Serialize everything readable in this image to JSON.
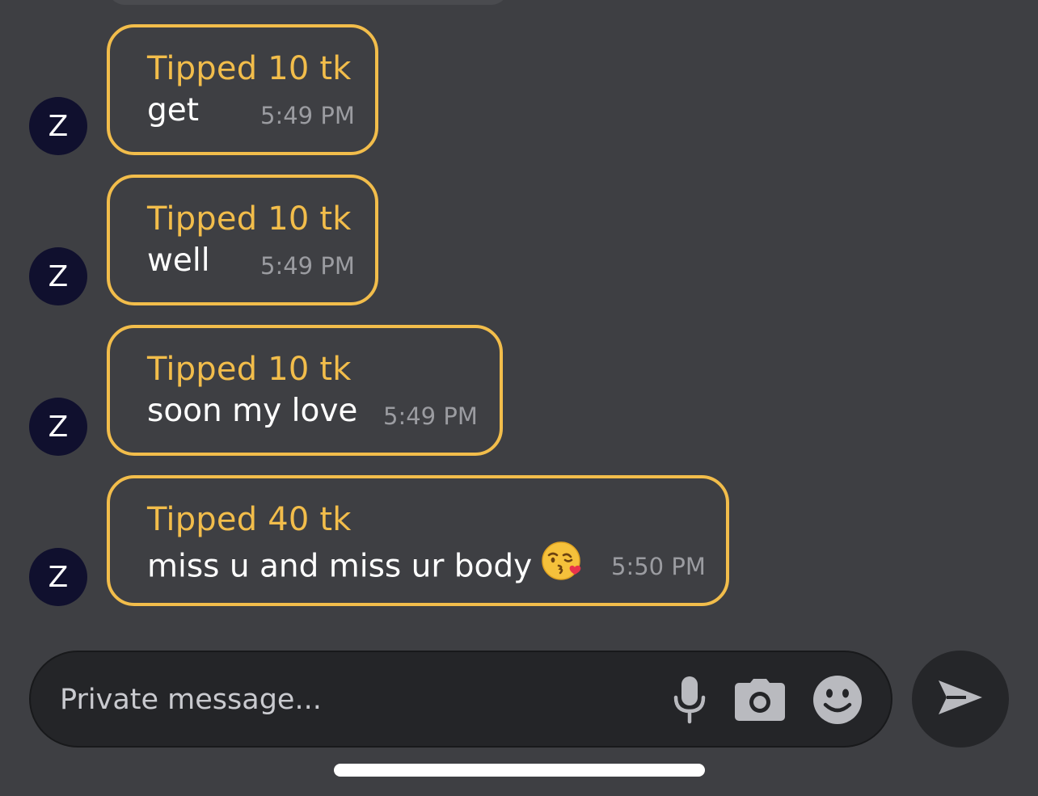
{
  "colors": {
    "background": "#3e3f43",
    "tip_accent": "#f2bd4b",
    "avatar_bg": "#10102e",
    "timestamp": "#9b9ca1",
    "input_bg": "#242528"
  },
  "messages": [
    {
      "avatar_initial": "Z",
      "tip_label": "Tipped 10 tk",
      "text": "get",
      "time": "5:49 PM"
    },
    {
      "avatar_initial": "Z",
      "tip_label": "Tipped 10 tk",
      "text": "well",
      "time": "5:49 PM"
    },
    {
      "avatar_initial": "Z",
      "tip_label": "Tipped 10 tk",
      "text": "soon my love",
      "time": "5:49 PM"
    },
    {
      "avatar_initial": "Z",
      "tip_label": "Tipped 40 tk",
      "text": "miss u and miss ur body",
      "emoji": "kissing-face-with-heart",
      "time": "5:50 PM"
    }
  ],
  "composer": {
    "placeholder": "Private message...",
    "icons": [
      "microphone-icon",
      "camera-icon",
      "emoji-icon"
    ],
    "send_icon": "send-arrow-icon"
  }
}
